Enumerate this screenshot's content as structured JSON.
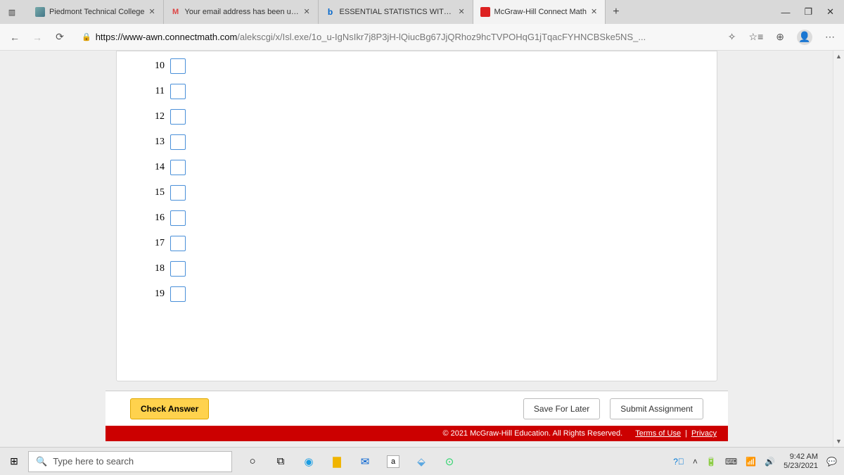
{
  "browser": {
    "tabs": [
      {
        "label": "Piedmont Technical College"
      },
      {
        "label": "Your email address has been upd"
      },
      {
        "label": "ESSENTIAL STATISTICS WITH CON"
      },
      {
        "label": "McGraw-Hill Connect Math"
      }
    ],
    "url_domain": "https://www-awn.connectmath.com",
    "url_path": "/alekscgi/x/Isl.exe/1o_u-IgNsIkr7j8P3jH-lQiucBg67JjQRhoz9hcTVPOHqG1jTqacFYHNCBSke5NS_..."
  },
  "question": {
    "rows": [
      {
        "num": "10"
      },
      {
        "num": "11"
      },
      {
        "num": "12"
      },
      {
        "num": "13"
      },
      {
        "num": "14"
      },
      {
        "num": "15"
      },
      {
        "num": "16"
      },
      {
        "num": "17"
      },
      {
        "num": "18"
      },
      {
        "num": "19"
      }
    ],
    "check_label": "Check Answer",
    "save_label": "Save For Later",
    "submit_label": "Submit Assignment"
  },
  "footer": {
    "copyright": "© 2021 McGraw-Hill Education. All Rights Reserved.",
    "terms": "Terms of Use",
    "privacy": "Privacy"
  },
  "taskbar": {
    "search_placeholder": "Type here to search",
    "time": "9:42 AM",
    "date": "5/23/2021"
  }
}
